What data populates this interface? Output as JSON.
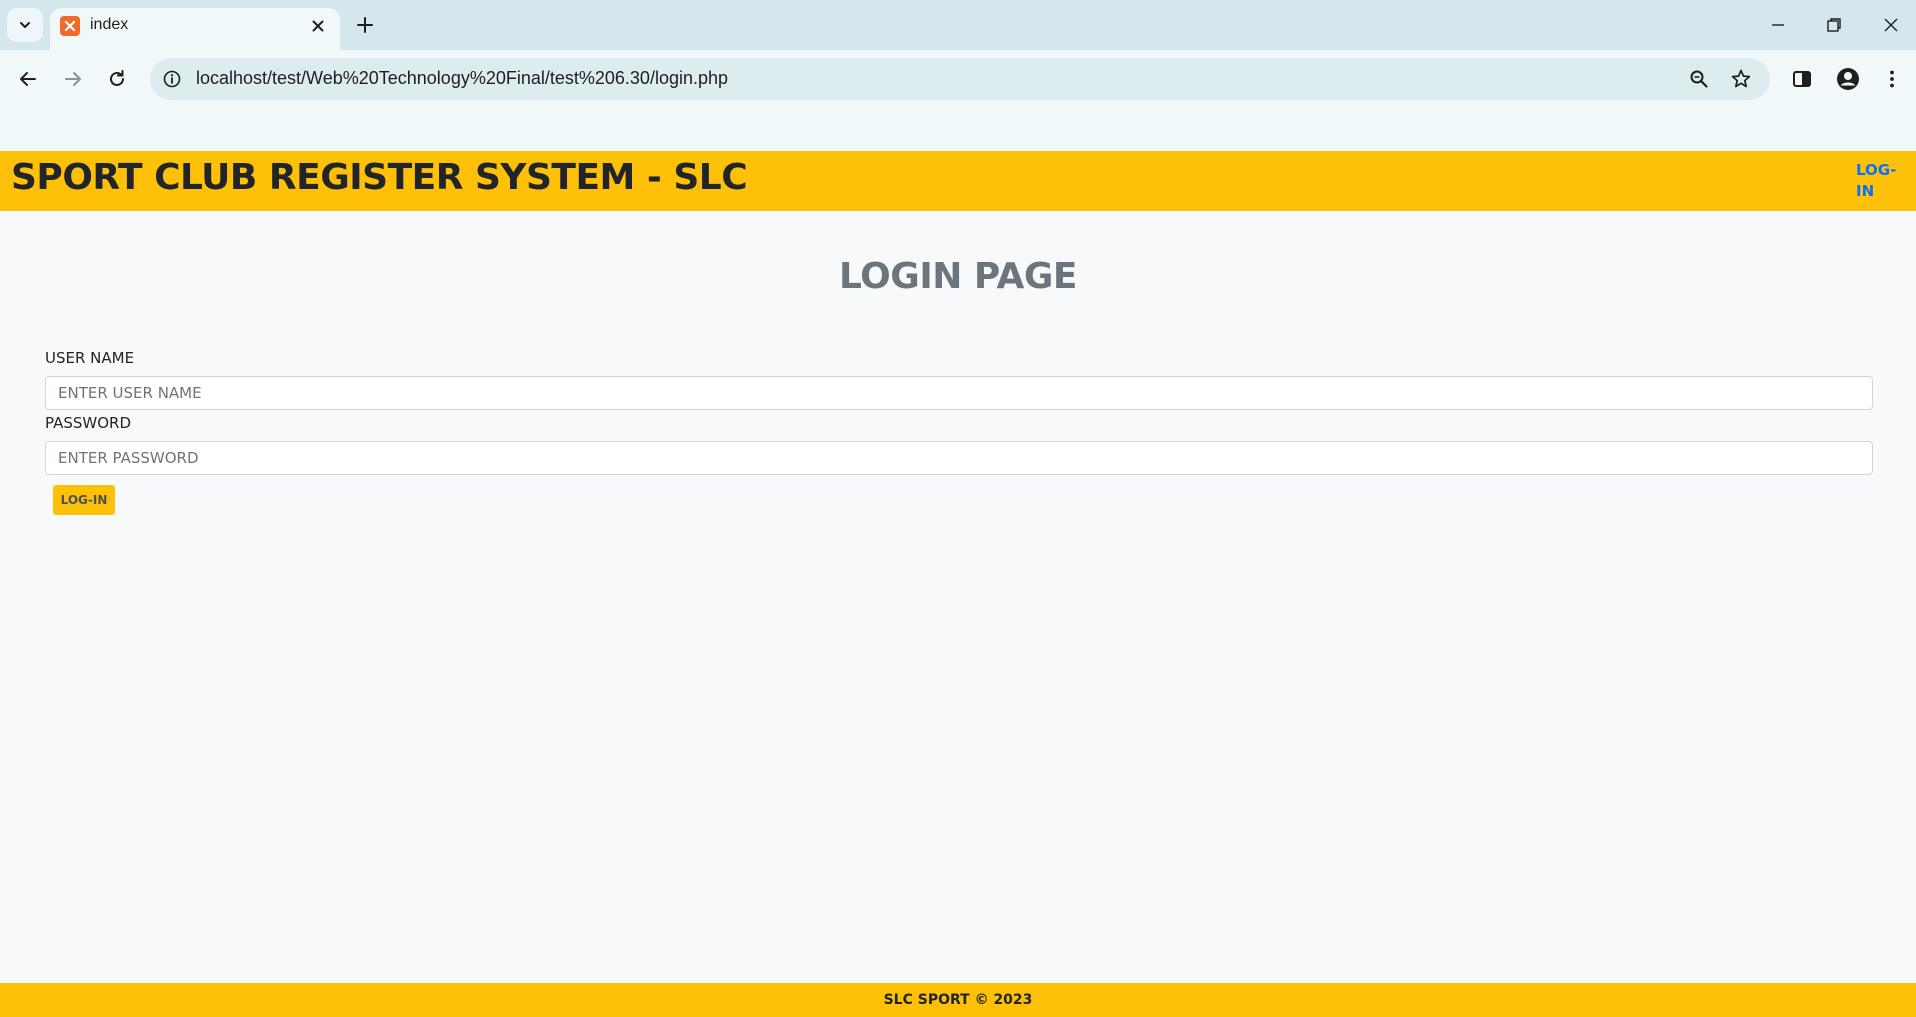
{
  "browser": {
    "tab_title": "index",
    "url": "localhost/test/Web%20Technology%20Final/test%206.30/login.php"
  },
  "header": {
    "site_title": "SPORT CLUB REGISTER SYSTEM - SLC",
    "nav_login": "LOG-IN"
  },
  "login_form": {
    "heading": "LOGIN PAGE",
    "username_label": "USER NAME",
    "username_placeholder": "ENTER USER NAME",
    "password_label": "PASSWORD",
    "password_placeholder": "ENTER PASSWORD",
    "submit_label": "LOG-IN"
  },
  "footer": {
    "text": "SLC SPORT © 2023"
  },
  "colors": {
    "header_bg": "#ffc107",
    "nav_link": "#0d6efd",
    "heading": "#6c757d",
    "page_bg": "#f8f9fa",
    "favicon": "#f26a2b"
  }
}
